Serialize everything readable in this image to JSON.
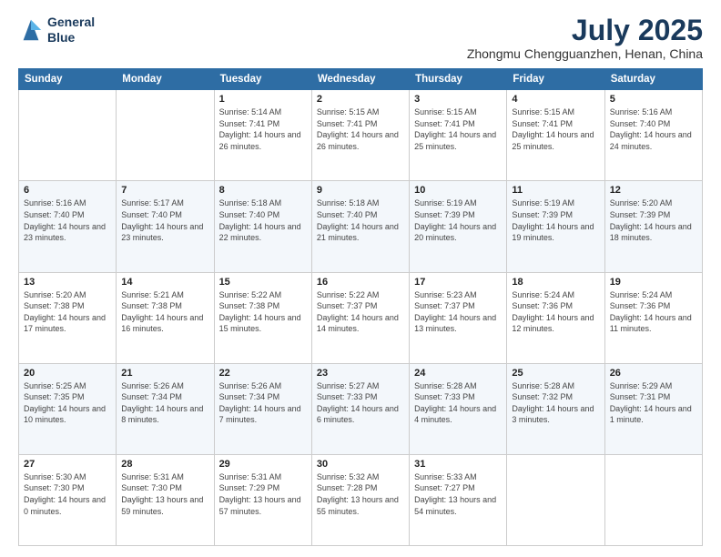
{
  "header": {
    "logo_line1": "General",
    "logo_line2": "Blue",
    "main_title": "July 2025",
    "subtitle": "Zhongmu Chengguanzhen, Henan, China"
  },
  "columns": [
    "Sunday",
    "Monday",
    "Tuesday",
    "Wednesday",
    "Thursday",
    "Friday",
    "Saturday"
  ],
  "weeks": [
    [
      {
        "day": "",
        "info": ""
      },
      {
        "day": "",
        "info": ""
      },
      {
        "day": "1",
        "info": "Sunrise: 5:14 AM\nSunset: 7:41 PM\nDaylight: 14 hours and 26 minutes."
      },
      {
        "day": "2",
        "info": "Sunrise: 5:15 AM\nSunset: 7:41 PM\nDaylight: 14 hours and 26 minutes."
      },
      {
        "day": "3",
        "info": "Sunrise: 5:15 AM\nSunset: 7:41 PM\nDaylight: 14 hours and 25 minutes."
      },
      {
        "day": "4",
        "info": "Sunrise: 5:15 AM\nSunset: 7:41 PM\nDaylight: 14 hours and 25 minutes."
      },
      {
        "day": "5",
        "info": "Sunrise: 5:16 AM\nSunset: 7:40 PM\nDaylight: 14 hours and 24 minutes."
      }
    ],
    [
      {
        "day": "6",
        "info": "Sunrise: 5:16 AM\nSunset: 7:40 PM\nDaylight: 14 hours and 23 minutes."
      },
      {
        "day": "7",
        "info": "Sunrise: 5:17 AM\nSunset: 7:40 PM\nDaylight: 14 hours and 23 minutes."
      },
      {
        "day": "8",
        "info": "Sunrise: 5:18 AM\nSunset: 7:40 PM\nDaylight: 14 hours and 22 minutes."
      },
      {
        "day": "9",
        "info": "Sunrise: 5:18 AM\nSunset: 7:40 PM\nDaylight: 14 hours and 21 minutes."
      },
      {
        "day": "10",
        "info": "Sunrise: 5:19 AM\nSunset: 7:39 PM\nDaylight: 14 hours and 20 minutes."
      },
      {
        "day": "11",
        "info": "Sunrise: 5:19 AM\nSunset: 7:39 PM\nDaylight: 14 hours and 19 minutes."
      },
      {
        "day": "12",
        "info": "Sunrise: 5:20 AM\nSunset: 7:39 PM\nDaylight: 14 hours and 18 minutes."
      }
    ],
    [
      {
        "day": "13",
        "info": "Sunrise: 5:20 AM\nSunset: 7:38 PM\nDaylight: 14 hours and 17 minutes."
      },
      {
        "day": "14",
        "info": "Sunrise: 5:21 AM\nSunset: 7:38 PM\nDaylight: 14 hours and 16 minutes."
      },
      {
        "day": "15",
        "info": "Sunrise: 5:22 AM\nSunset: 7:38 PM\nDaylight: 14 hours and 15 minutes."
      },
      {
        "day": "16",
        "info": "Sunrise: 5:22 AM\nSunset: 7:37 PM\nDaylight: 14 hours and 14 minutes."
      },
      {
        "day": "17",
        "info": "Sunrise: 5:23 AM\nSunset: 7:37 PM\nDaylight: 14 hours and 13 minutes."
      },
      {
        "day": "18",
        "info": "Sunrise: 5:24 AM\nSunset: 7:36 PM\nDaylight: 14 hours and 12 minutes."
      },
      {
        "day": "19",
        "info": "Sunrise: 5:24 AM\nSunset: 7:36 PM\nDaylight: 14 hours and 11 minutes."
      }
    ],
    [
      {
        "day": "20",
        "info": "Sunrise: 5:25 AM\nSunset: 7:35 PM\nDaylight: 14 hours and 10 minutes."
      },
      {
        "day": "21",
        "info": "Sunrise: 5:26 AM\nSunset: 7:34 PM\nDaylight: 14 hours and 8 minutes."
      },
      {
        "day": "22",
        "info": "Sunrise: 5:26 AM\nSunset: 7:34 PM\nDaylight: 14 hours and 7 minutes."
      },
      {
        "day": "23",
        "info": "Sunrise: 5:27 AM\nSunset: 7:33 PM\nDaylight: 14 hours and 6 minutes."
      },
      {
        "day": "24",
        "info": "Sunrise: 5:28 AM\nSunset: 7:33 PM\nDaylight: 14 hours and 4 minutes."
      },
      {
        "day": "25",
        "info": "Sunrise: 5:28 AM\nSunset: 7:32 PM\nDaylight: 14 hours and 3 minutes."
      },
      {
        "day": "26",
        "info": "Sunrise: 5:29 AM\nSunset: 7:31 PM\nDaylight: 14 hours and 1 minute."
      }
    ],
    [
      {
        "day": "27",
        "info": "Sunrise: 5:30 AM\nSunset: 7:30 PM\nDaylight: 14 hours and 0 minutes."
      },
      {
        "day": "28",
        "info": "Sunrise: 5:31 AM\nSunset: 7:30 PM\nDaylight: 13 hours and 59 minutes."
      },
      {
        "day": "29",
        "info": "Sunrise: 5:31 AM\nSunset: 7:29 PM\nDaylight: 13 hours and 57 minutes."
      },
      {
        "day": "30",
        "info": "Sunrise: 5:32 AM\nSunset: 7:28 PM\nDaylight: 13 hours and 55 minutes."
      },
      {
        "day": "31",
        "info": "Sunrise: 5:33 AM\nSunset: 7:27 PM\nDaylight: 13 hours and 54 minutes."
      },
      {
        "day": "",
        "info": ""
      },
      {
        "day": "",
        "info": ""
      }
    ]
  ]
}
